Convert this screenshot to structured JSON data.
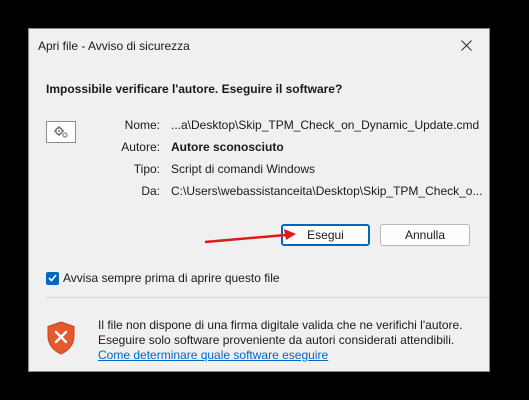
{
  "window": {
    "title": "Apri file - Avviso di sicurezza"
  },
  "dialog": {
    "question": "Impossibile verificare l'autore. Eseguire il software?",
    "fields": [
      {
        "label": "Nome:",
        "value": "...a\\Desktop\\Skip_TPM_Check_on_Dynamic_Update.cmd"
      },
      {
        "label": "Autore:",
        "value": "Autore sconosciuto"
      },
      {
        "label": "Tipo:",
        "value": "Script di comandi Windows"
      },
      {
        "label": "Da:",
        "value": "C:\\Users\\webassistanceita\\Desktop\\Skip_TPM_Check_o..."
      }
    ],
    "run_button": "Esegui",
    "cancel_button": "Annulla",
    "checkbox_label": "Avvisa sempre prima di aprire questo file",
    "checkbox_checked": true,
    "warning_lines": [
      "Il file non dispone di una firma digitale valida che ne verifichi l'autore.",
      "Eseguire solo software proveniente da autori considerati attendibili."
    ],
    "help_link": "Come determinare quale software eseguire"
  },
  "colors": {
    "accent": "#0067c0",
    "annotation_arrow": "#e01919",
    "shield": "#e35a2b"
  },
  "icons": {
    "file": "script-file-icon",
    "shield": "security-shield-icon",
    "close": "close-icon"
  }
}
